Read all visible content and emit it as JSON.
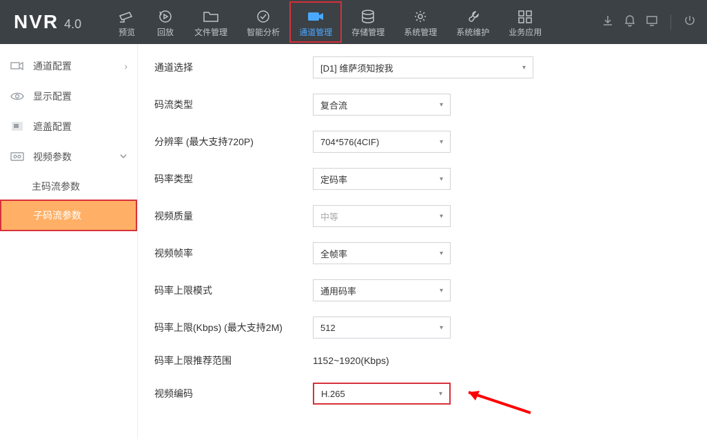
{
  "logo": {
    "brand": "NVR",
    "version": "4.0"
  },
  "nav": {
    "items": [
      {
        "label": "预览"
      },
      {
        "label": "回放"
      },
      {
        "label": "文件管理"
      },
      {
        "label": "智能分析"
      },
      {
        "label": "通道管理"
      },
      {
        "label": "存储管理"
      },
      {
        "label": "系统管理"
      },
      {
        "label": "系统维护"
      },
      {
        "label": "业务应用"
      }
    ]
  },
  "sidebar": {
    "items": [
      {
        "label": "通道配置"
      },
      {
        "label": "显示配置"
      },
      {
        "label": "遮盖配置"
      },
      {
        "label": "视频参数"
      }
    ],
    "sub": [
      {
        "label": "主码流参数"
      },
      {
        "label": "子码流参数"
      }
    ]
  },
  "form": {
    "channel_label": "通道选择",
    "channel_value": "[D1] 维萨须知按我",
    "stream_type_label": "码流类型",
    "stream_type_value": "复合流",
    "resolution_label": "分辨率 (最大支持720P)",
    "resolution_value": "704*576(4CIF)",
    "bitrate_type_label": "码率类型",
    "bitrate_type_value": "定码率",
    "quality_label": "视频质量",
    "quality_value": "中等",
    "framerate_label": "视频帧率",
    "framerate_value": "全帧率",
    "max_mode_label": "码率上限模式",
    "max_mode_value": "通用码率",
    "max_kbps_label": "码率上限(Kbps) (最大支持2M)",
    "max_kbps_value": "512",
    "recommend_label": "码率上限推荐范围",
    "recommend_value": "1152~1920(Kbps)",
    "codec_label": "视频编码",
    "codec_value": "H.265"
  }
}
